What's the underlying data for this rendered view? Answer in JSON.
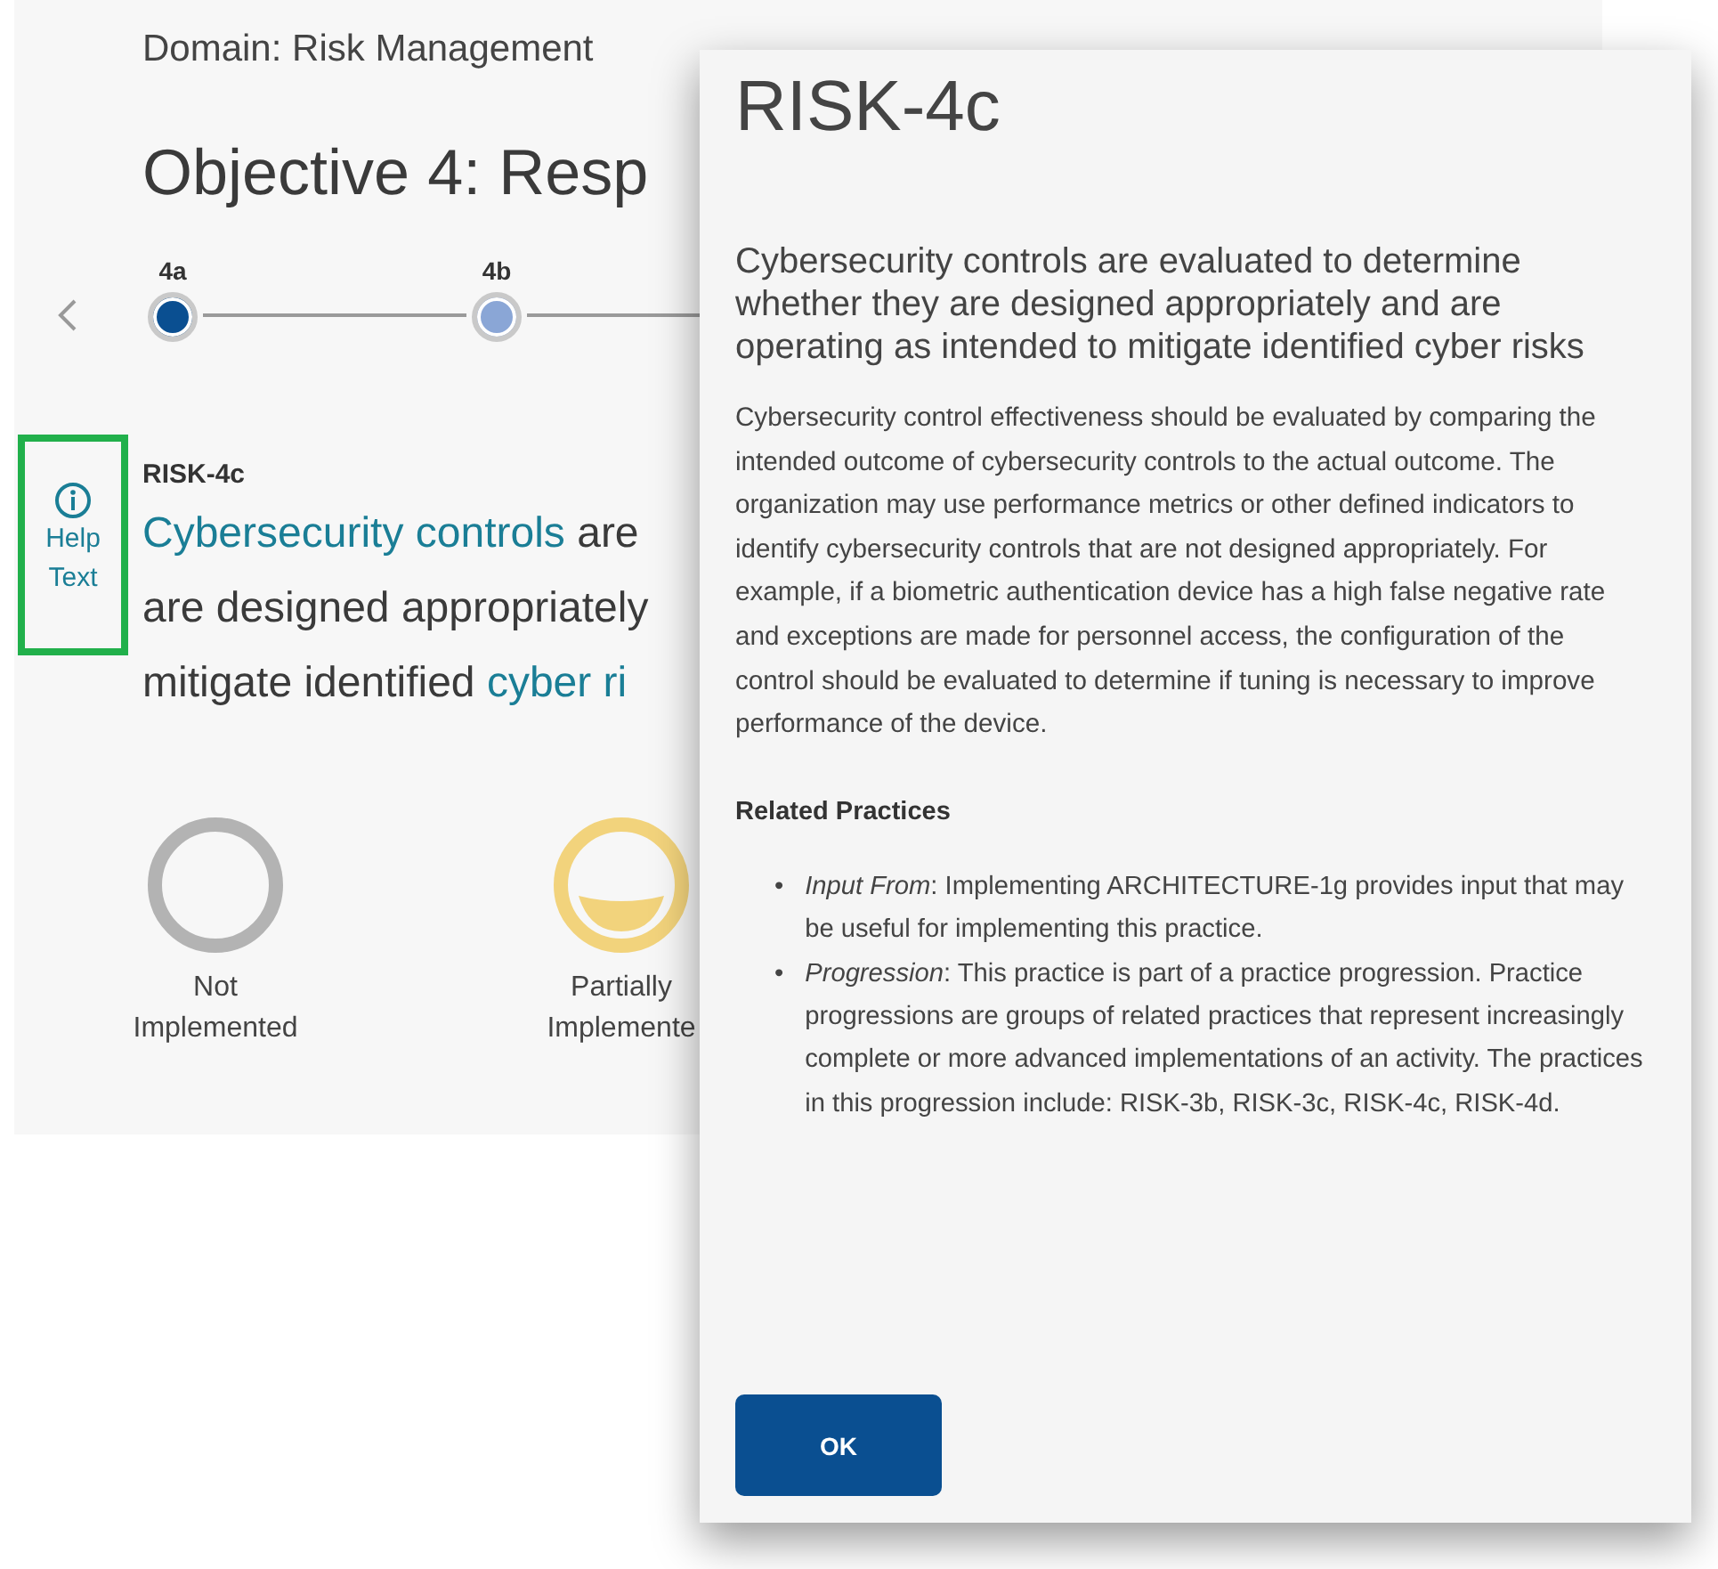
{
  "page": {
    "domain": "Domain: Risk Management",
    "objective": "Objective 4: Resp",
    "steps": [
      {
        "label": "4a",
        "selected": true
      },
      {
        "label": "4b",
        "selected": false
      }
    ],
    "help_button": {
      "label_lines": [
        "Help",
        "Text"
      ],
      "highlighted": true
    },
    "practice": {
      "id": "RISK-4c",
      "lines": [
        [
          {
            "kind": "link",
            "text": "Cybersecurity controls"
          },
          {
            "kind": "text",
            "text": " are"
          }
        ],
        [
          {
            "kind": "text",
            "text": "are designed appropriately"
          }
        ],
        [
          {
            "kind": "text",
            "text": "mitigate identified "
          },
          {
            "kind": "link",
            "text": "cyber ri"
          }
        ]
      ]
    },
    "ratings": [
      {
        "kind": "none",
        "lines": [
          "Not",
          "Implemented"
        ]
      },
      {
        "kind": "partial",
        "lines": [
          "Partially",
          "Implemente"
        ]
      }
    ]
  },
  "dialog": {
    "title": "RISK-4c",
    "heading": "Cybersecurity controls are evaluated to determine whether they are designed appropriately and are operating as intended to mitigate identified cyber risks",
    "body": "Cybersecurity control effectiveness should be evaluated by comparing the intended outcome of cybersecurity controls to the actual outcome. The organization may use performance metrics or other defined indicators to identify cybersecurity controls that are not designed appropriately. For example, if a biometric authentication device has a high false negative rate and exceptions are made for personnel access, the configuration of the control should be evaluated to determine if tuning is necessary to improve performance of the device.",
    "related_heading": "Related Practices",
    "related": [
      {
        "bullet": "•",
        "text": "*Input From*: Implementing ARCHITECTURE-1g provides input that may be useful for implementing this practice."
      },
      {
        "bullet": "•",
        "text": "*Progression*: This practice is part of a practice progression. Practice progressions are groups of related practices that represent increasingly complete or more advanced implementations of an activity. The practices in this progression include: RISK-3b, RISK-3c, RISK-4c, RISK-4d."
      }
    ],
    "ok": "OK"
  }
}
